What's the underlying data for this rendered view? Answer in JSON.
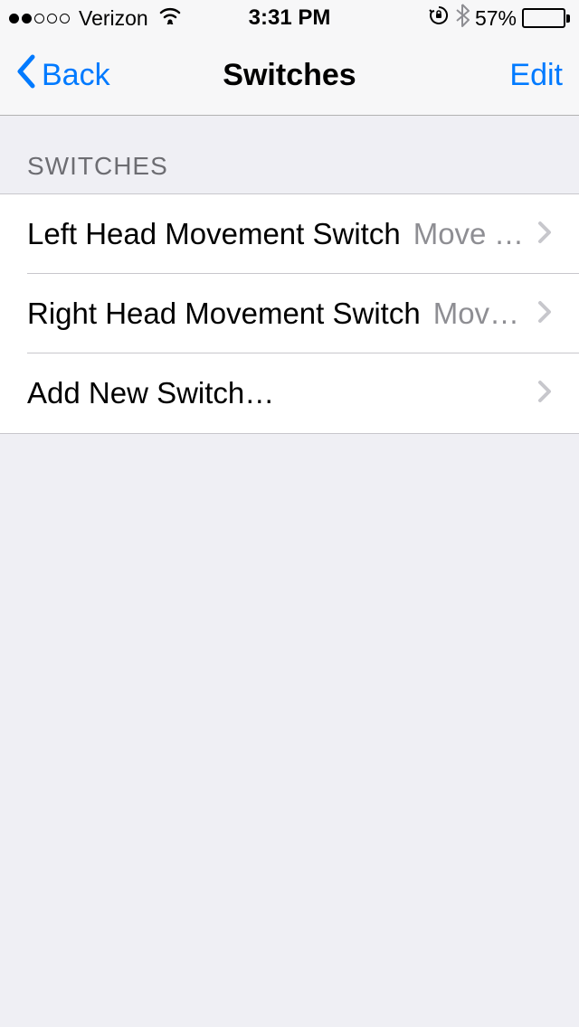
{
  "status_bar": {
    "carrier": "Verizon",
    "time": "3:31 PM",
    "battery_pct": "57%"
  },
  "nav": {
    "back_label": "Back",
    "title": "Switches",
    "edit_label": "Edit"
  },
  "section": {
    "header": "SWITCHES",
    "rows": [
      {
        "label": "Left Head Movement Switch",
        "value": "Move To Next Item"
      },
      {
        "label": "Right Head Movement Switch",
        "value": "Move To Next Item"
      },
      {
        "label": "Add New Switch…",
        "value": ""
      }
    ]
  }
}
